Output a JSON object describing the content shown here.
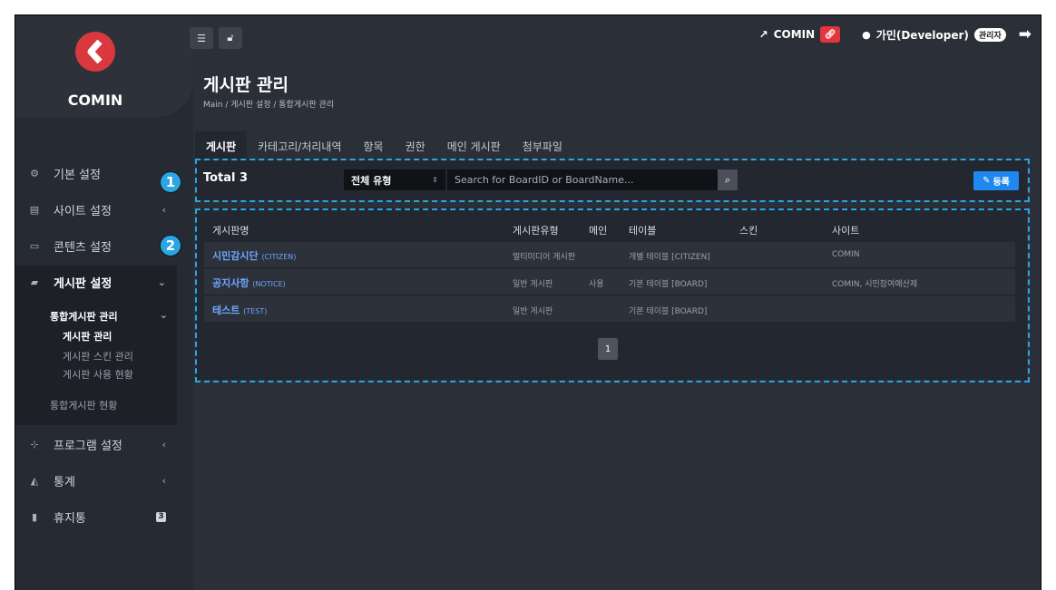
{
  "brand": {
    "name": "COMIN",
    "logo_color": "#d9383f"
  },
  "topbar": {
    "site_link_label": "COMIN",
    "user_label": "가민(Developer)",
    "role_badge": "관리자"
  },
  "sidebar": {
    "items": [
      {
        "label": "기본 설정",
        "icon": "gears-icon",
        "has_chevron": false
      },
      {
        "label": "사이트 설정",
        "icon": "server-icon",
        "has_chevron": true
      },
      {
        "label": "콘텐츠 설정",
        "icon": "hdd-icon",
        "has_chevron": false
      },
      {
        "label": "게시판 설정",
        "icon": "comments-icon",
        "has_chevron": true,
        "active": true
      },
      {
        "label": "프로그램 설정",
        "icon": "sitemap-icon",
        "has_chevron": true
      },
      {
        "label": "통계",
        "icon": "area-chart-icon",
        "has_chevron": true
      },
      {
        "label": "휴지통",
        "icon": "trash-icon",
        "badge": "3"
      }
    ],
    "submenu": {
      "group_label": "통합게시판 관리",
      "children": [
        "게시판 관리",
        "게시판 스킨 관리",
        "게시판 사용 현황"
      ],
      "other_label": "통합게시판 현황"
    }
  },
  "page": {
    "title": "게시판 관리",
    "breadcrumb": "Main  /  게시판 설정  /  통합게시판 관리"
  },
  "tabs": [
    "게시판",
    "카테고리/처리내역",
    "항목",
    "권한",
    "메인 게시판",
    "첨부파일"
  ],
  "toolbar": {
    "total_label": "Total 3",
    "type_select_value": "전체 유형",
    "search_placeholder": "Search for BoardID or BoardName...",
    "register_label": "등록"
  },
  "table": {
    "headers": [
      "게시판명",
      "게시판유형",
      "메인",
      "테이블",
      "스킨",
      "사이트"
    ],
    "rows": [
      {
        "name": "시민감시단",
        "id": "(CITIZEN)",
        "type": "멀티미디어 게시판",
        "main": "",
        "table": "개별 테이블 [CITIZEN]",
        "skin": "",
        "site": "COMIN"
      },
      {
        "name": "공지사항",
        "id": "(NOTICE)",
        "type": "일반 게시판",
        "main": "사용",
        "table": "기본 테이블 [BOARD]",
        "skin": "",
        "site": "COMIN, 시민참여예산제"
      },
      {
        "name": "테스트",
        "id": "(TEST)",
        "type": "일반 게시판",
        "main": "",
        "table": "기본 테이블 [BOARD]",
        "skin": "",
        "site": ""
      }
    ]
  },
  "pagination": {
    "current": "1"
  },
  "callouts": [
    "1",
    "2"
  ]
}
